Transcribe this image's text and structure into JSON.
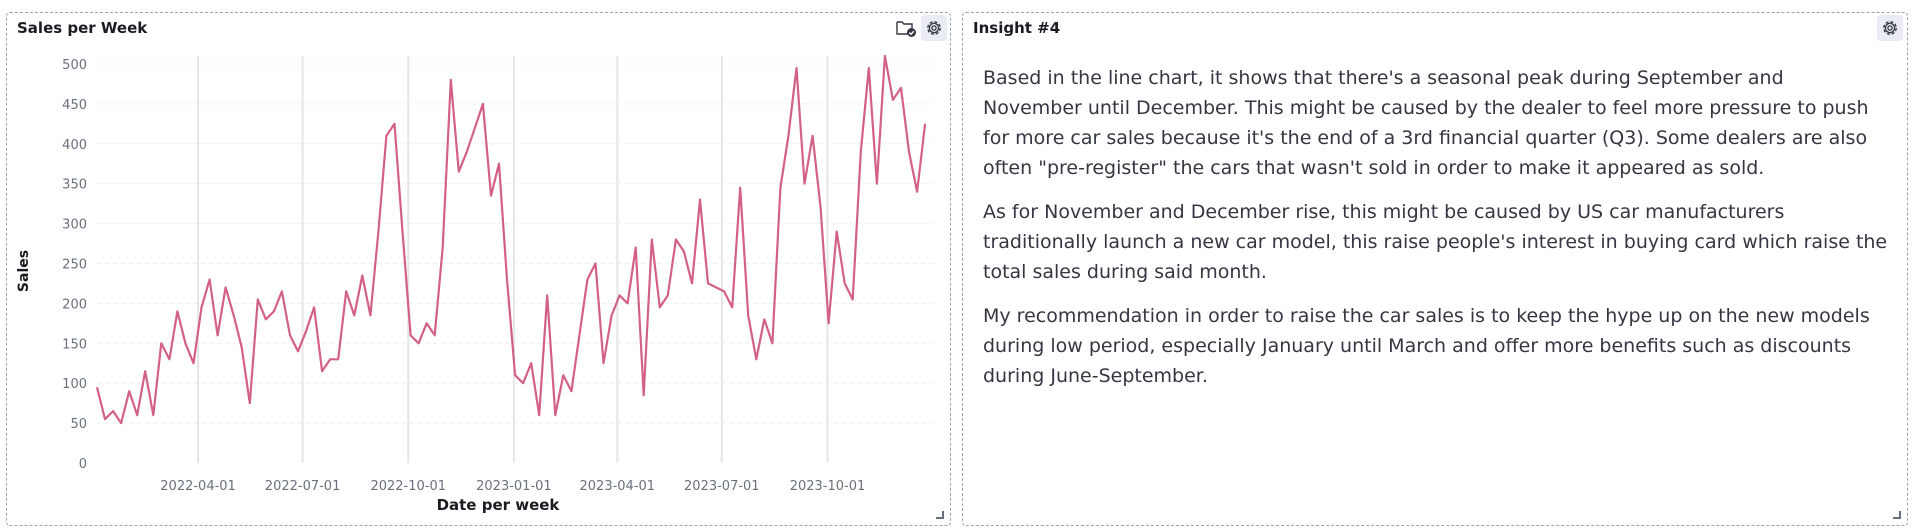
{
  "chart_panel": {
    "title": "Sales per Week"
  },
  "insight_panel": {
    "title": "Insight #4",
    "paragraphs": [
      "Based in the line chart, it shows that there's a seasonal peak during September and November until December. This might be caused by the dealer to feel more pressure to push for more car sales because it's the end of a 3rd financial quarter (Q3). Some dealers are also often \"pre-register\" the cars that wasn't sold in order to make it appeared as sold.",
      "As for November and December rise, this might be caused by US car manufacturers traditionally launch a new car model, this raise people's interest in buying card which raise the total sales during said month.",
      "My recommendation in order to raise the car sales is to keep the hype up on the new models during low period, especially January until March and offer more benefits such as discounts during June-September."
    ]
  },
  "colors": {
    "line": "#d36086",
    "grid": "#eeeeee",
    "axis_text": "#69707d",
    "title_text": "#1a1c21",
    "panel_border": "#98a2b3"
  },
  "icons": [
    "folder-check-icon",
    "gear-icon",
    "resize-handle-icon"
  ],
  "chart_data": {
    "type": "line",
    "title": "Sales per Week",
    "xlabel": "Date per week",
    "ylabel": "Sales",
    "ylim": [
      0,
      510
    ],
    "xlim": [
      "2022-01-03",
      "2023-12-31"
    ],
    "yticks": [
      0,
      50,
      100,
      150,
      200,
      250,
      300,
      350,
      400,
      450,
      500
    ],
    "xticks": [
      "2022-04-01",
      "2022-07-01",
      "2022-10-01",
      "2023-01-01",
      "2023-04-01",
      "2023-07-01",
      "2023-10-01"
    ],
    "grid": true,
    "series": [
      {
        "color": "#d36086",
        "x": [
          "2022-01-03",
          "2022-01-10",
          "2022-01-17",
          "2022-01-24",
          "2022-01-31",
          "2022-02-07",
          "2022-02-14",
          "2022-02-21",
          "2022-02-28",
          "2022-03-07",
          "2022-03-14",
          "2022-03-21",
          "2022-03-28",
          "2022-04-04",
          "2022-04-11",
          "2022-04-18",
          "2022-04-25",
          "2022-05-02",
          "2022-05-09",
          "2022-05-16",
          "2022-05-23",
          "2022-05-30",
          "2022-06-06",
          "2022-06-13",
          "2022-06-20",
          "2022-06-27",
          "2022-07-04",
          "2022-07-11",
          "2022-07-18",
          "2022-07-25",
          "2022-08-01",
          "2022-08-08",
          "2022-08-15",
          "2022-08-22",
          "2022-08-29",
          "2022-09-05",
          "2022-09-12",
          "2022-09-19",
          "2022-09-26",
          "2022-10-03",
          "2022-10-10",
          "2022-10-17",
          "2022-10-24",
          "2022-10-31",
          "2022-11-07",
          "2022-11-14",
          "2022-11-21",
          "2022-11-28",
          "2022-12-05",
          "2022-12-12",
          "2022-12-19",
          "2022-12-26",
          "2023-01-02",
          "2023-01-09",
          "2023-01-16",
          "2023-01-23",
          "2023-01-30",
          "2023-02-06",
          "2023-02-13",
          "2023-02-20",
          "2023-02-27",
          "2023-03-06",
          "2023-03-13",
          "2023-03-20",
          "2023-03-27",
          "2023-04-03",
          "2023-04-10",
          "2023-04-17",
          "2023-04-24",
          "2023-05-01",
          "2023-05-08",
          "2023-05-15",
          "2023-05-22",
          "2023-05-29",
          "2023-06-05",
          "2023-06-12",
          "2023-06-19",
          "2023-06-26",
          "2023-07-03",
          "2023-07-10",
          "2023-07-17",
          "2023-07-24",
          "2023-07-31",
          "2023-08-07",
          "2023-08-14",
          "2023-08-21",
          "2023-08-28",
          "2023-09-04",
          "2023-09-11",
          "2023-09-18",
          "2023-09-25",
          "2023-10-02",
          "2023-10-09",
          "2023-10-16",
          "2023-10-23",
          "2023-10-30",
          "2023-11-06",
          "2023-11-13",
          "2023-11-20",
          "2023-11-27",
          "2023-12-04",
          "2023-12-11",
          "2023-12-18",
          "2023-12-25"
        ],
        "y": [
          95,
          55,
          65,
          50,
          90,
          60,
          115,
          60,
          150,
          130,
          190,
          150,
          125,
          195,
          230,
          160,
          220,
          185,
          145,
          75,
          205,
          180,
          190,
          215,
          160,
          140,
          165,
          195,
          115,
          130,
          130,
          215,
          185,
          235,
          185,
          290,
          410,
          425,
          290,
          160,
          150,
          175,
          160,
          270,
          480,
          365,
          390,
          420,
          450,
          335,
          375,
          230,
          110,
          100,
          125,
          60,
          210,
          60,
          110,
          90,
          160,
          230,
          250,
          125,
          185,
          210,
          200,
          270,
          85,
          280,
          195,
          210,
          280,
          265,
          225,
          330,
          225,
          220,
          215,
          195,
          345,
          185,
          130,
          180,
          150,
          345,
          410,
          495,
          350,
          410,
          320,
          175,
          290,
          225,
          205,
          390,
          495,
          350,
          510,
          455,
          470,
          390,
          340,
          425
        ]
      }
    ]
  }
}
